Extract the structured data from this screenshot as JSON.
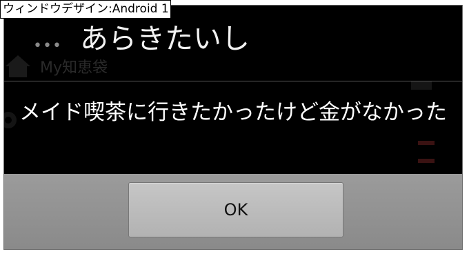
{
  "caption": "ウィンドウデザイン:Android 1",
  "background_app": {
    "title": "My知恵袋",
    "home_icon": "home-icon",
    "settings_icon": "gear-icon"
  },
  "dialog": {
    "menu_icon": "ellipsis-icon",
    "title": "あらきたいし",
    "message": "メイド喫茶に行きたかったけど金がなかった",
    "ok_label": "OK"
  },
  "colors": {
    "dialog_bg": "#000000",
    "title_text": "#f2f2f2",
    "button_bar": "#949494",
    "button": "#bcbcbc"
  }
}
